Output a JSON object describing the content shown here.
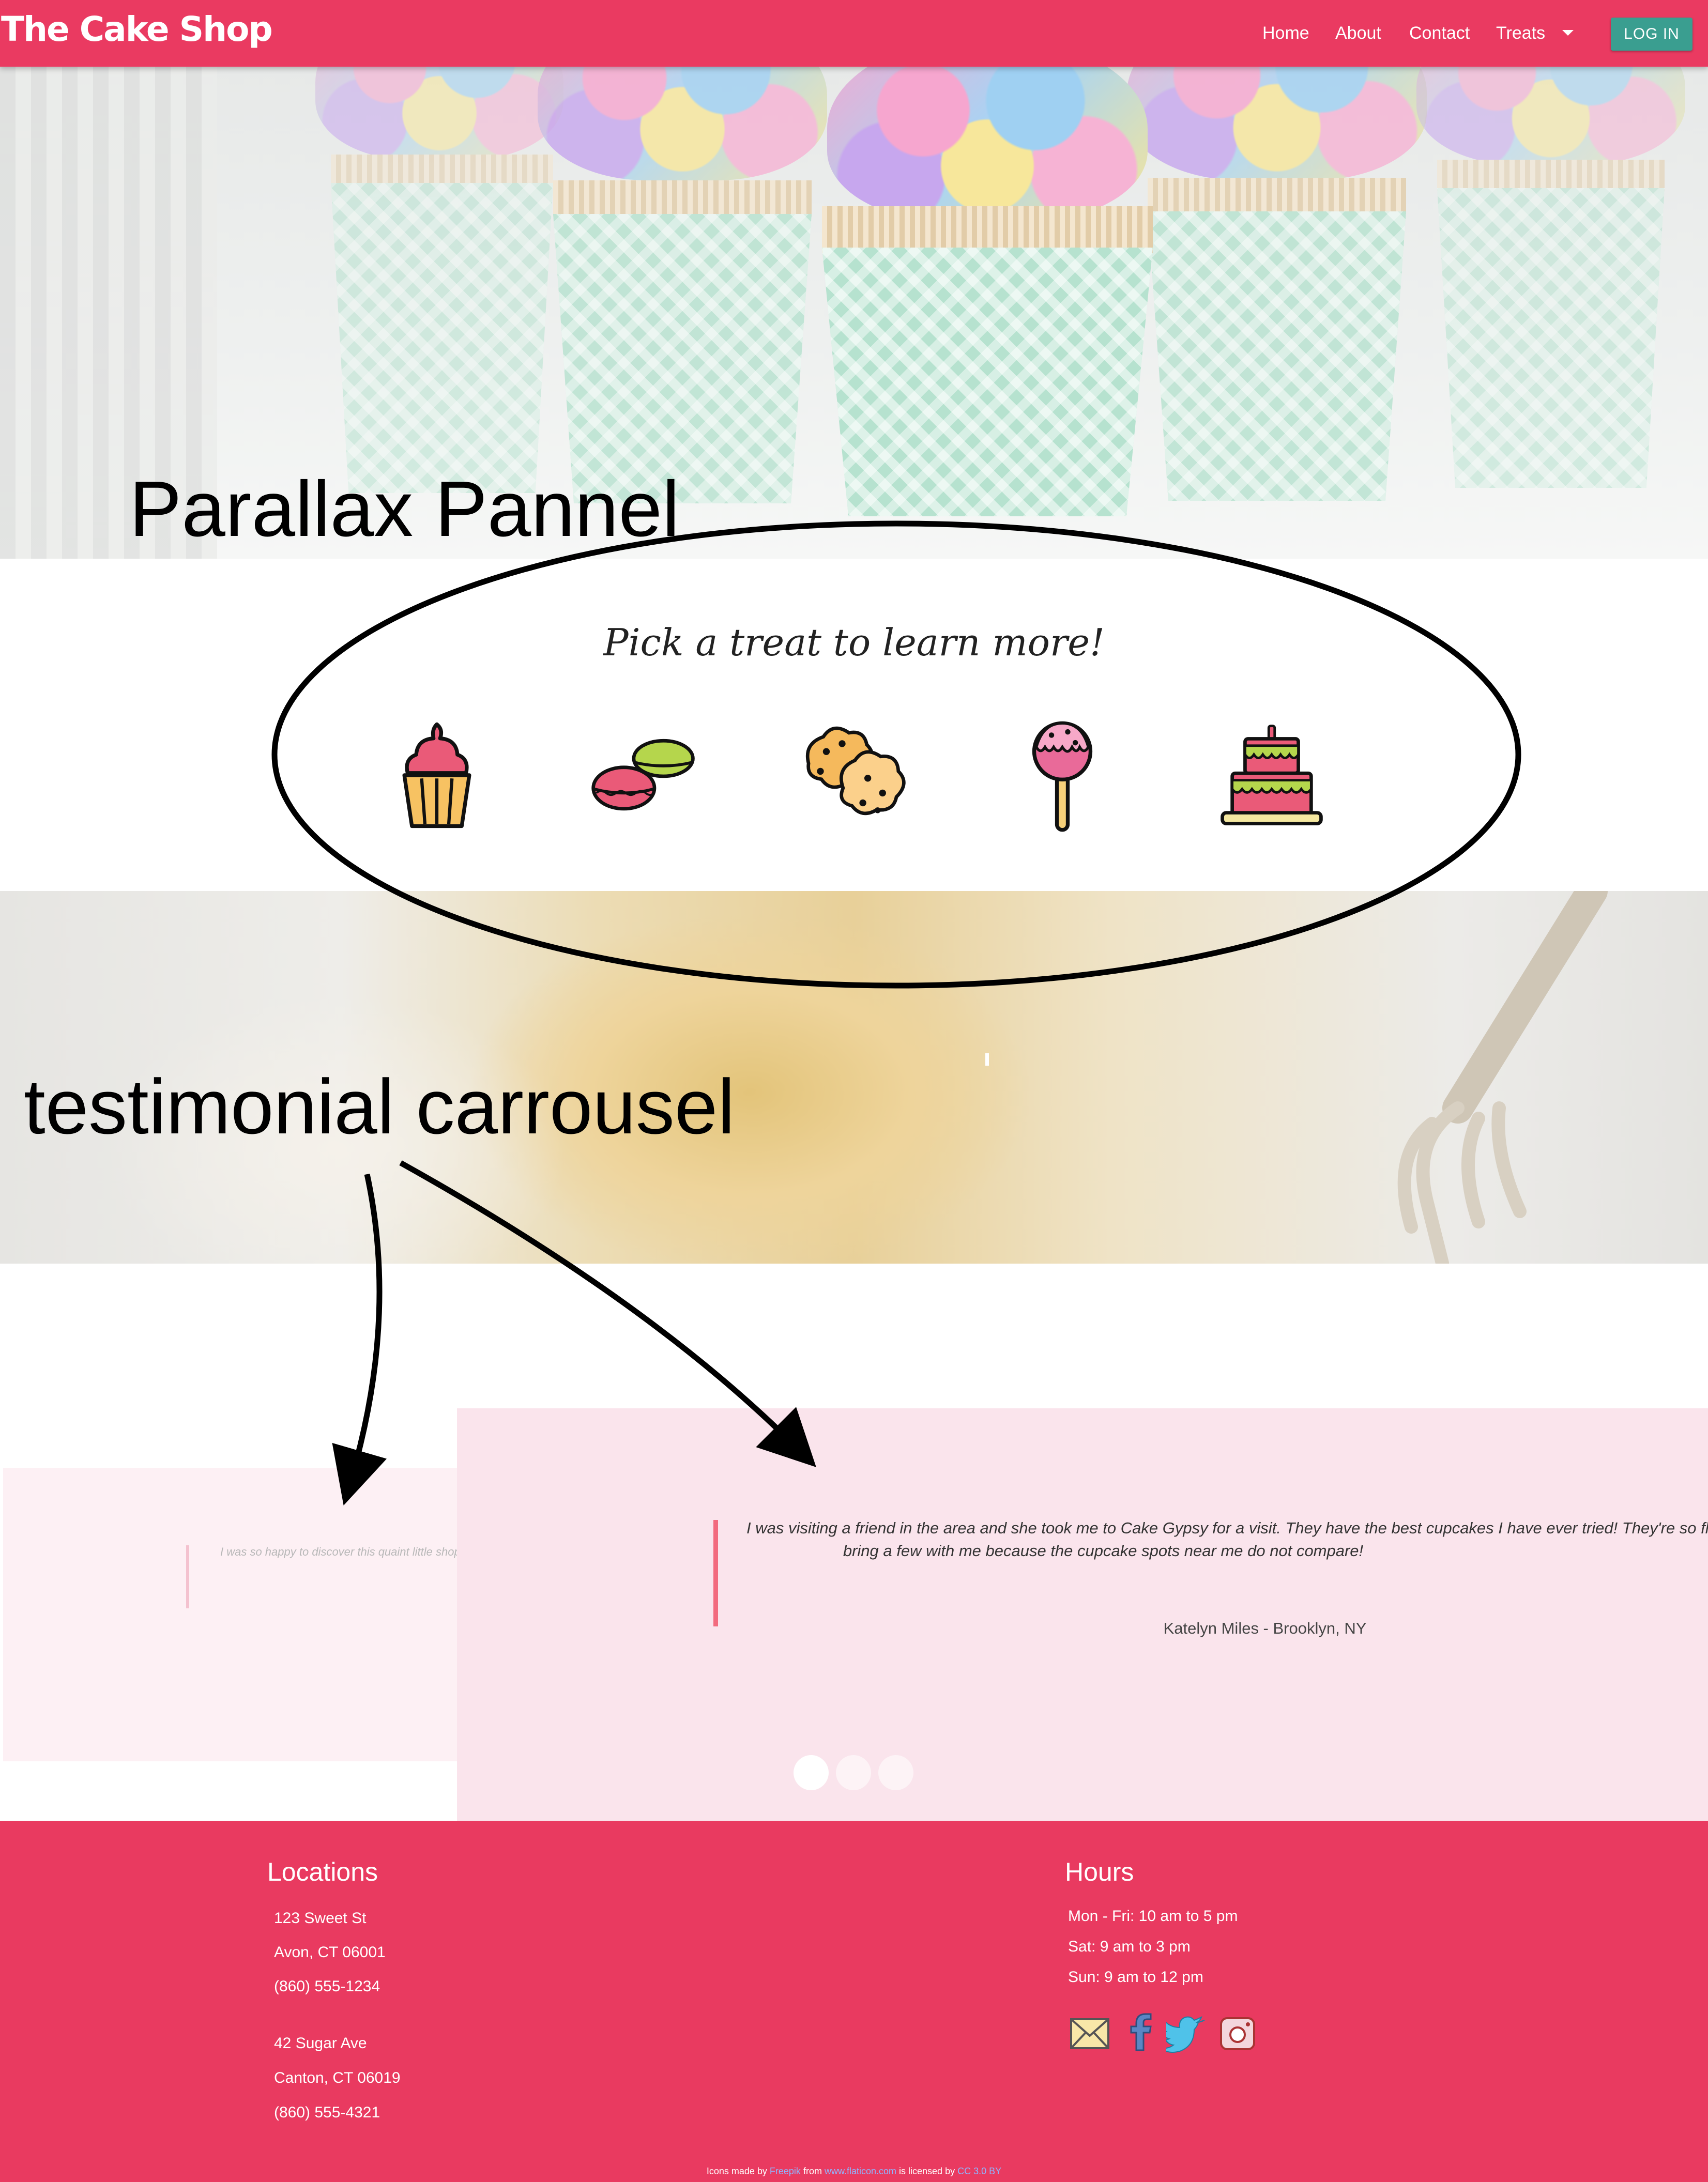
{
  "navbar": {
    "brand": "The Cake Shop",
    "links": [
      "Home",
      "About",
      "Contact",
      "Treats"
    ],
    "login": "LOG IN",
    "color": "#ea3a61"
  },
  "annotations": {
    "parallax": "Parallax Pannel",
    "testimonial": "testimonial carrousel"
  },
  "treats": {
    "title": "Pick a treat to learn more!",
    "items": [
      {
        "icon": "cupcake-icon"
      },
      {
        "icon": "macaron-icon"
      },
      {
        "icon": "cookie-icon"
      },
      {
        "icon": "cake-pop-icon"
      },
      {
        "icon": "layer-cake-icon"
      }
    ]
  },
  "testimonials": {
    "prev_quote": "I was so happy to discover this quaint little shop",
    "quote": "I was visiting a friend in the area and she took me to Cake Gypsy for a visit. They have the best cupcakes I have ever tried! They're so fluffy and moist. I will definitely bring a few with me because the cupcake spots near me do not compare!",
    "quote_line1": "I was visiting a friend in the area and she took me to Cake Gypsy for a visit. They have the best cupcakes I have ever tried! They're so fl",
    "quote_line2": "bring a few with me because the cupcake spots near me do not compare!",
    "author": "Katelyn Miles - Brooklyn, NY",
    "dots": 3,
    "active_dot": 0
  },
  "footer": {
    "locations_title": "Locations",
    "location1": [
      "123 Sweet St",
      "Avon, CT 06001",
      "(860) 555-1234"
    ],
    "location2": [
      "42 Sugar Ave",
      "Canton, CT 06019",
      "(860) 555-4321"
    ],
    "hours_title": "Hours",
    "hours": [
      "Mon - Fri: 10 am to 5 pm",
      "Sat: 9 am to 3 pm",
      "Sun: 9 am to 12 pm"
    ],
    "social_icons": [
      "email-icon",
      "facebook-icon",
      "twitter-icon",
      "instagram-icon"
    ],
    "credit_prefix": "Icons made by",
    "credit_author": "Freepik",
    "credit_from": "from",
    "credit_site": "www.flaticon.com",
    "credit_licensed": "is licensed by",
    "credit_license": "CC 3.0 BY"
  }
}
